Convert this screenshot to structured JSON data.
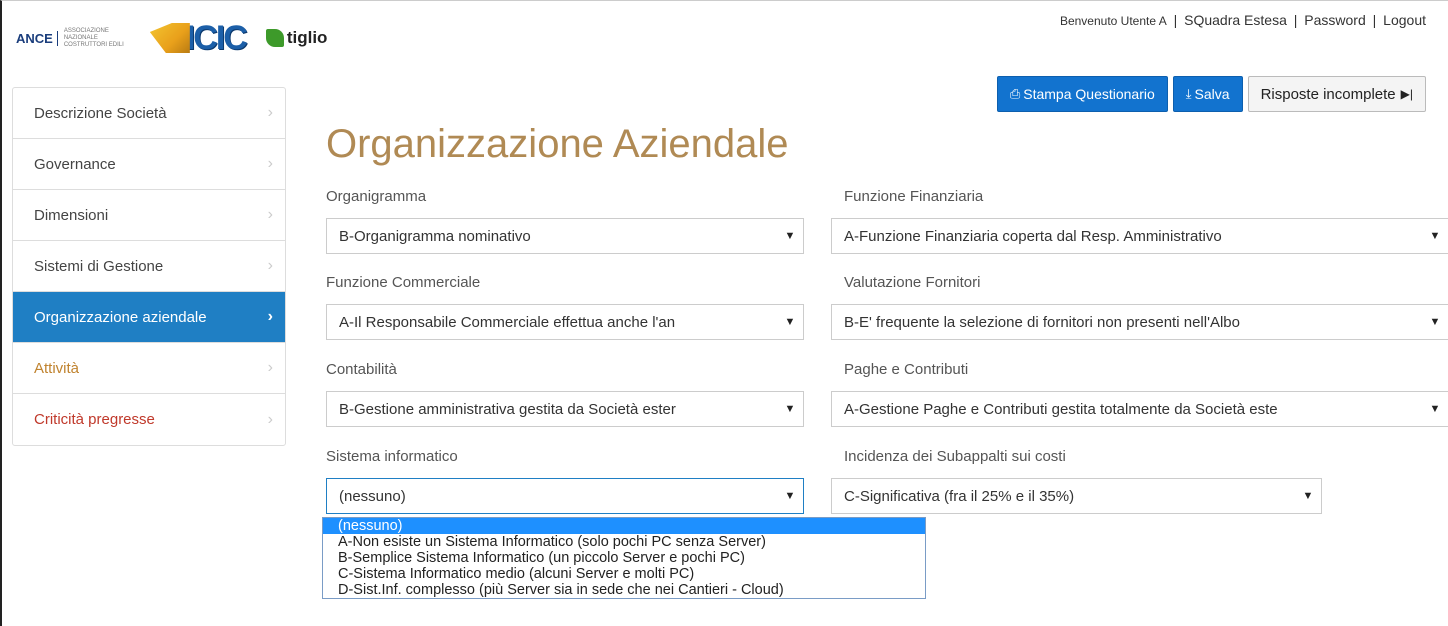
{
  "header": {
    "logo_ance": "ANCE",
    "logo_ance_sub": "ASSOCIAZIONE NAZIONALE COSTRUTTORI EDILI",
    "logo_icic": "ICIC",
    "logo_tiglio": "tiglio",
    "welcome": "Benvenuto Utente A",
    "links": [
      "SQuadra Estesa",
      "Password",
      "Logout"
    ],
    "separator": "|"
  },
  "sidebar": {
    "items": [
      {
        "label": "Descrizione Società"
      },
      {
        "label": "Governance"
      },
      {
        "label": "Dimensioni"
      },
      {
        "label": "Sistemi di Gestione"
      },
      {
        "label": "Organizzazione aziendale"
      },
      {
        "label": "Attività"
      },
      {
        "label": "Criticità pregresse"
      }
    ],
    "active_index": 4,
    "chevron": "›"
  },
  "toolbar": {
    "print_label": "Stampa Questionario",
    "save_label": "Salva",
    "incomplete_label": "Risposte incomplete"
  },
  "page": {
    "title": "Organizzazione Aziendale"
  },
  "fields": {
    "organigramma": {
      "label": "Organigramma",
      "value": "B-Organigramma nominativo"
    },
    "funzione_finanziaria": {
      "label": "Funzione Finanziaria",
      "value": "A-Funzione Finanziaria coperta dal Resp. Amministrativo"
    },
    "funzione_commerciale": {
      "label": "Funzione Commerciale",
      "value": "A-Il Responsabile Commerciale effettua anche l'an"
    },
    "valutazione_fornitori": {
      "label": "Valutazione Fornitori",
      "value": "B-E' frequente la selezione di fornitori non presenti nell'Albo"
    },
    "contabilita": {
      "label": "Contabilità",
      "value": "B-Gestione amministrativa gestita da Società ester"
    },
    "paghe_contributi": {
      "label": "Paghe e Contributi",
      "value": "A-Gestione Paghe e Contributi gestita totalmente da Società este"
    },
    "sistema_informatico": {
      "label": "Sistema informatico",
      "value": "(nessuno)",
      "options": [
        "(nessuno)",
        "A-Non esiste un Sistema Informatico (solo pochi PC senza Server)",
        "B-Semplice Sistema Informatico (un piccolo Server e pochi PC)",
        "C-Sistema Informatico medio (alcuni Server e molti PC)",
        "D-Sist.Inf. complesso (più Server sia in sede che nei Cantieri - Cloud)"
      ]
    },
    "incidenza_subappalti": {
      "label": "Incidenza dei Subappalti sui costi",
      "value": "C-Significativa (fra il 25% e il 35%)"
    }
  },
  "colors": {
    "accent": "#1f7fc4",
    "title": "#b08a54",
    "primary_button": "#1273cf"
  }
}
